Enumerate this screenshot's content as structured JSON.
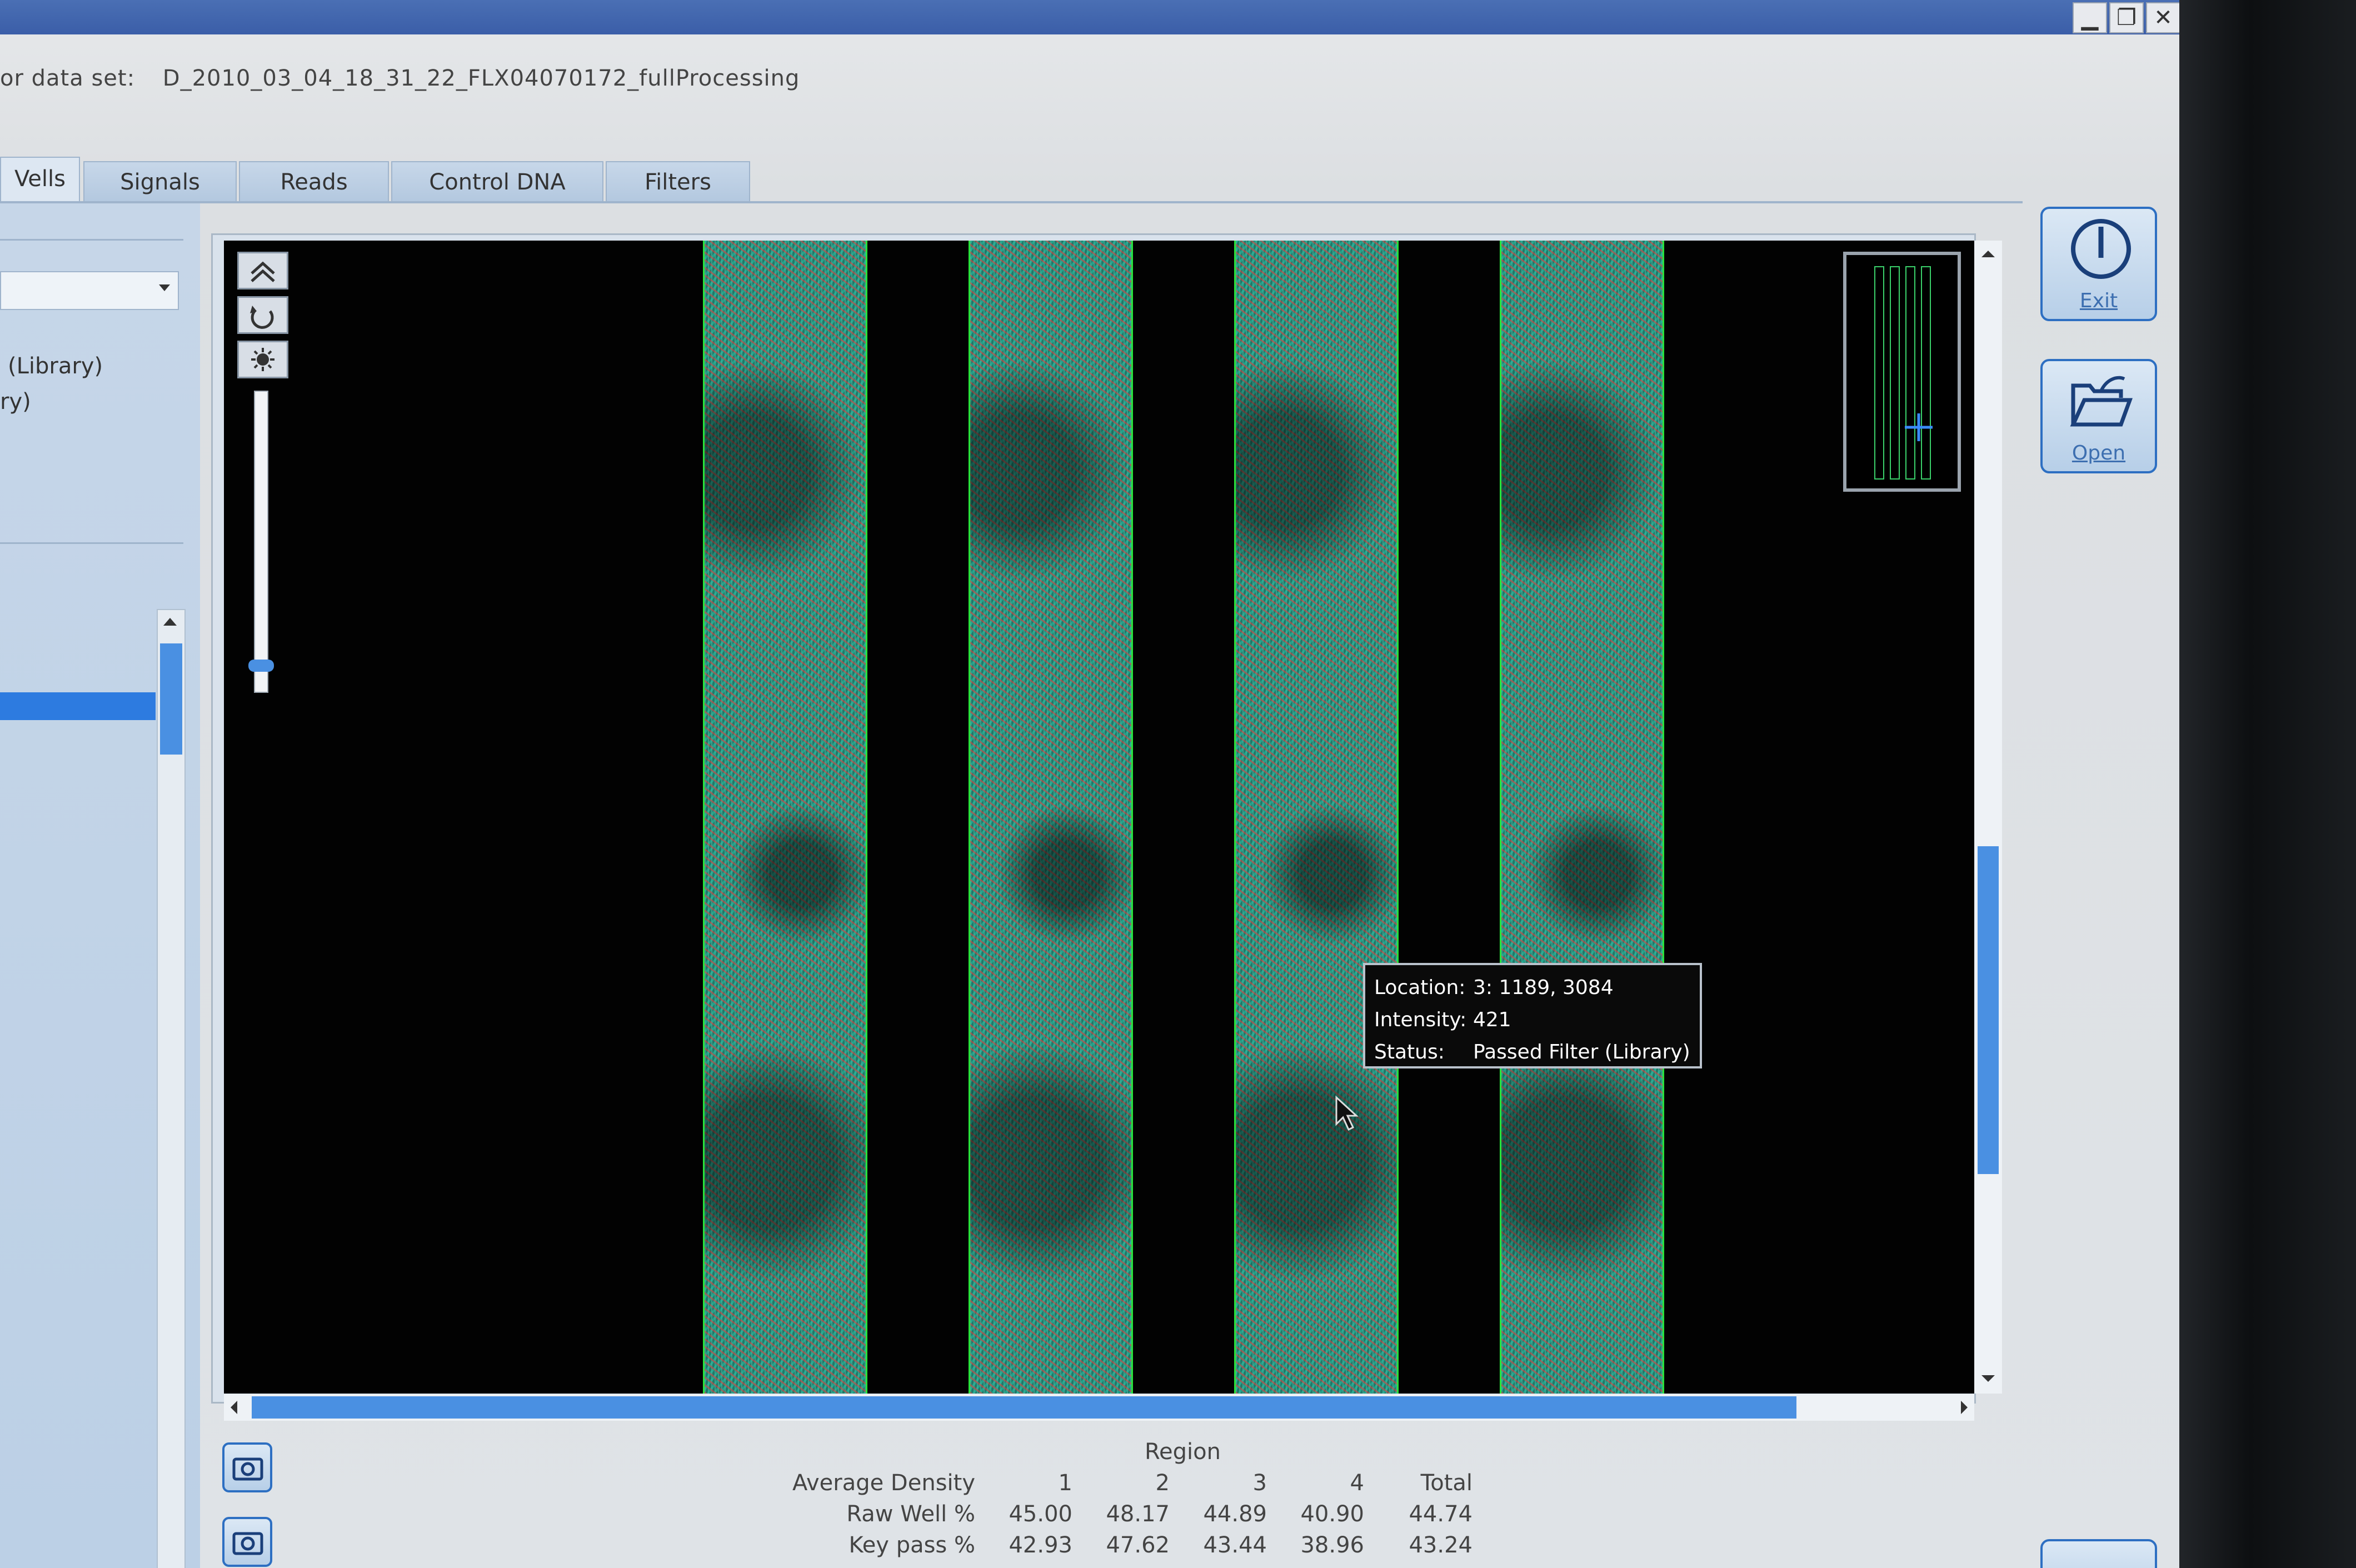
{
  "window": {
    "dataset_label": "or data set:",
    "dataset_value": "D_2010_03_04_18_31_22_FLX04070172_fullProcessing",
    "minimize": "▁",
    "maximize": "❐",
    "close": "✕"
  },
  "tabs": [
    {
      "label": "Vells"
    },
    {
      "label": "Signals"
    },
    {
      "label": "Reads"
    },
    {
      "label": "Control DNA"
    },
    {
      "label": "Filters"
    }
  ],
  "left_panel": {
    "option_1": "(Library)",
    "option_2": "ry)"
  },
  "viewer": {
    "zoom_level": 0.07,
    "tooltip": {
      "location_key": "Location:",
      "location_value": "3: 1189, 3084",
      "intensity_key": "Intensity:",
      "intensity_value": "421",
      "status_key": "Status:",
      "status_value": "Passed Filter (Library)"
    },
    "colors": {
      "lane_outline": "#28e23a",
      "scroll_thumb": "#4a90e2"
    }
  },
  "side_buttons": {
    "exit_label": "Exit",
    "open_label": "Open"
  },
  "stats": {
    "region_title": "Region",
    "header": [
      "Average Density",
      "1",
      "2",
      "3",
      "4",
      "Total"
    ],
    "rows": [
      {
        "label": "Raw Well %",
        "values": [
          "45.00",
          "48.17",
          "44.89",
          "40.90",
          "44.74"
        ]
      },
      {
        "label": "Key pass %",
        "values": [
          "42.93",
          "47.62",
          "43.44",
          "38.96",
          "43.24"
        ]
      }
    ]
  }
}
